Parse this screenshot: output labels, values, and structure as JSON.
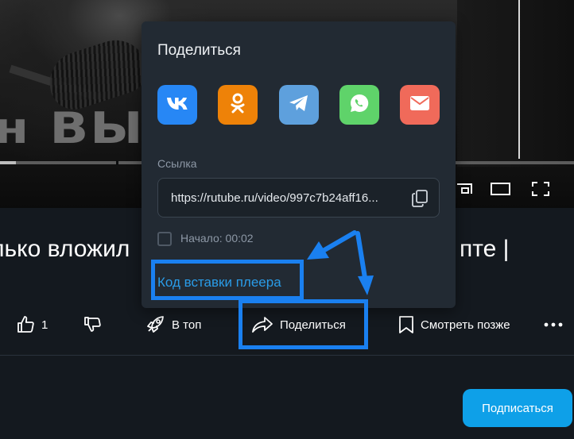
{
  "video": {
    "overlay_text": "н ВЫП"
  },
  "title": {
    "visible_start": "лько вложил",
    "visible_end": "пте |"
  },
  "actions": {
    "likes_count": "1",
    "top_label": "В топ",
    "share_label": "Поделиться",
    "watch_later_label": "Смотреть позже"
  },
  "subscribe_label": "Подписаться",
  "share_popup": {
    "title": "Поделиться",
    "socials": [
      {
        "name": "vk",
        "icon": "vk-icon",
        "color": "#2787f5"
      },
      {
        "name": "odnoklassniki",
        "icon": "odnoklassniki-icon",
        "color": "#ee8208"
      },
      {
        "name": "telegram",
        "icon": "telegram-icon",
        "color": "#5ea0dd"
      },
      {
        "name": "whatsapp",
        "icon": "whatsapp-icon",
        "color": "#5fd36a"
      },
      {
        "name": "email",
        "icon": "mail-icon",
        "color": "#f06a5a"
      }
    ],
    "link_label": "Ссылка",
    "link_value": "https://rutube.ru/video/997c7b24aff16...",
    "start_label": "Начало: 00:02",
    "start_checked": false,
    "embed_label": "Код вставки плеера"
  },
  "colors": {
    "accent": "#0ea0e8",
    "annotation": "#1a80f0",
    "popup_bg": "#222a33",
    "page_bg": "#14191f"
  }
}
